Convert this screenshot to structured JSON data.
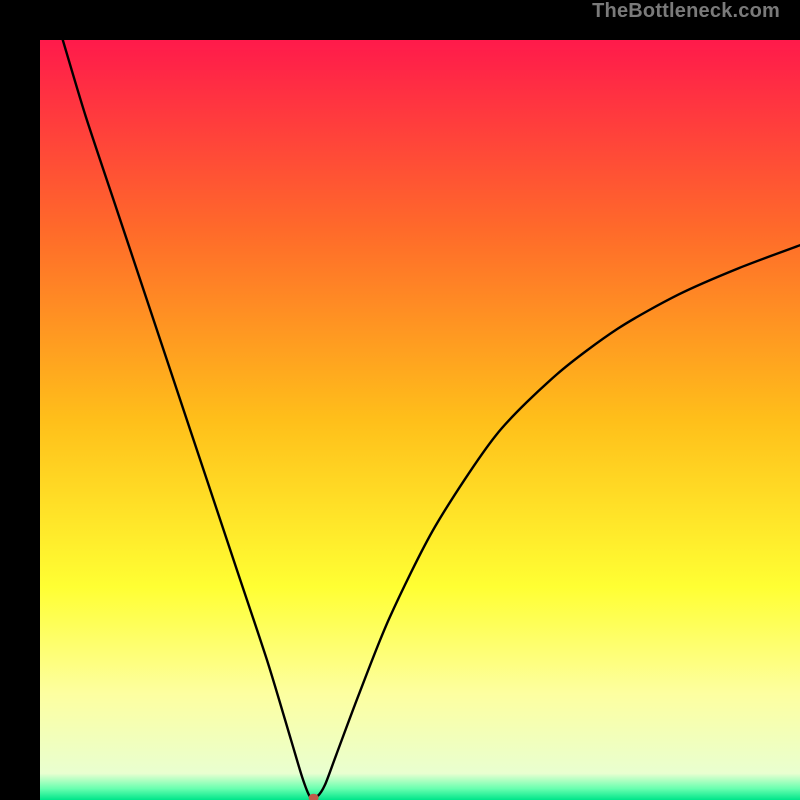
{
  "watermark": "TheBottleneck.com",
  "chart_data": {
    "type": "line",
    "title": "",
    "xlabel": "",
    "ylabel": "",
    "xlim": [
      0,
      100
    ],
    "ylim": [
      0,
      100
    ],
    "grid": false,
    "legend": false,
    "background_gradient": {
      "stops": [
        {
          "pos": 0.0,
          "color": "#ff1a4b"
        },
        {
          "pos": 0.25,
          "color": "#ff6a2a"
        },
        {
          "pos": 0.5,
          "color": "#ffbf1a"
        },
        {
          "pos": 0.72,
          "color": "#ffff33"
        },
        {
          "pos": 0.86,
          "color": "#fdffa0"
        },
        {
          "pos": 0.965,
          "color": "#e9ffd0"
        },
        {
          "pos": 0.985,
          "color": "#69ffb0"
        },
        {
          "pos": 1.0,
          "color": "#00e58a"
        }
      ]
    },
    "series": [
      {
        "name": "bottleneck-curve",
        "x": [
          3,
          6,
          10,
          14,
          18,
          22,
          26,
          30,
          33,
          34.5,
          35.5,
          36.5,
          37.5,
          39,
          42,
          46,
          52,
          60,
          68,
          76,
          84,
          92,
          100
        ],
        "y": [
          100,
          90,
          78,
          66,
          54,
          42,
          30,
          18,
          8,
          3,
          0.5,
          0.5,
          2,
          6,
          14,
          24,
          36,
          48,
          56,
          62,
          66.5,
          70,
          73
        ]
      }
    ],
    "marker": {
      "x": 36,
      "y": 0.3,
      "color": "#c05a4a",
      "rx": 5,
      "ry": 4
    },
    "flat_segment": {
      "x0": 34.5,
      "x1": 37.5,
      "y": 0.3
    }
  }
}
